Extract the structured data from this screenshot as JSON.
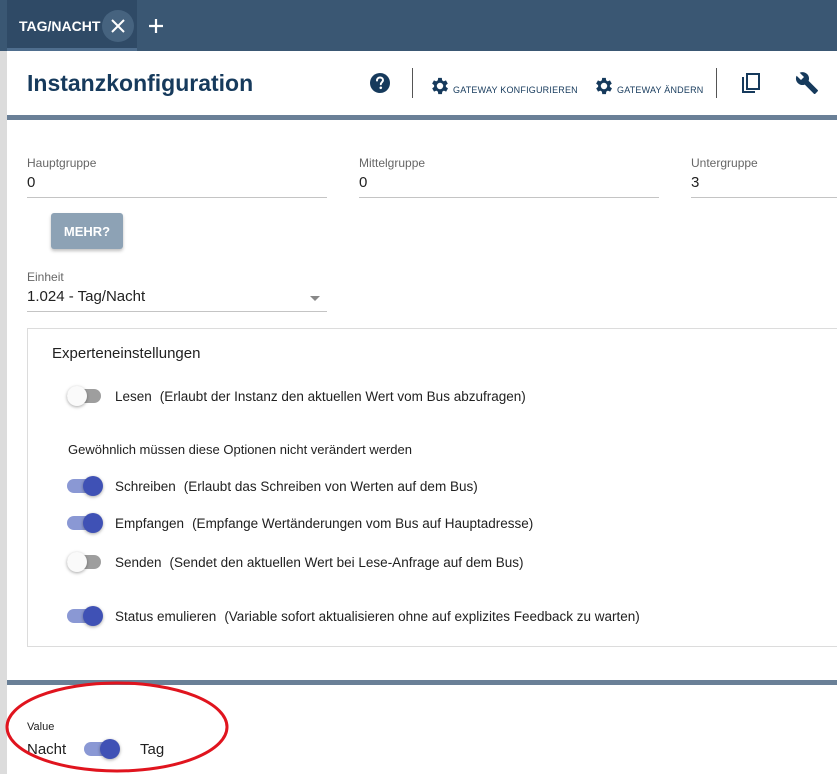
{
  "tab": {
    "label": "TAG/NACHT"
  },
  "header": {
    "title": "Instanzkonfiguration",
    "configure_gateway": "GATEWAY KONFIGURIEREN",
    "change_gateway": "GATEWAY ÄNDERN"
  },
  "fields": {
    "main_group": {
      "label": "Hauptgruppe",
      "value": "0"
    },
    "middle_group": {
      "label": "Mittelgruppe",
      "value": "0"
    },
    "sub_group": {
      "label": "Untergruppe",
      "value": "3"
    },
    "more_button": "MEHR?",
    "unit": {
      "label": "Einheit",
      "value": "1.024 - Tag/Nacht"
    }
  },
  "expert": {
    "title": "Experteneinstellungen",
    "read": {
      "name": "Lesen",
      "desc": "(Erlaubt der Instanz den aktuellen Wert vom Bus abzufragen)",
      "on": false
    },
    "hint": "Gewöhnlich müssen diese Optionen nicht verändert werden",
    "write": {
      "name": "Schreiben",
      "desc": "(Erlaubt das Schreiben von Werten auf dem Bus)",
      "on": true
    },
    "receive": {
      "name": "Empfangen",
      "desc": "(Empfange Wertänderungen vom Bus auf Hauptadresse)",
      "on": true
    },
    "send": {
      "name": "Senden",
      "desc": "(Sendet den aktuellen Wert bei Lese-Anfrage auf dem Bus)",
      "on": false
    },
    "emulate": {
      "name": "Status emulieren",
      "desc": "(Variable sofort aktualisieren ohne auf explizites Feedback zu warten)",
      "on": true
    }
  },
  "value": {
    "label": "Value",
    "off_label": "Nacht",
    "on_label": "Tag",
    "on": true
  },
  "colors": {
    "tabbar": "#3a5773",
    "title": "#163a5c",
    "toggle_on": "#3f51b5",
    "annotation": "#e0141e"
  },
  "icons": {
    "tab_close": "close-icon",
    "tab_add": "plus-icon",
    "help": "help-circle-icon",
    "configure": "gear-icon",
    "change": "gear-icon",
    "copy": "copy-icon",
    "tools": "wrench-icon"
  }
}
